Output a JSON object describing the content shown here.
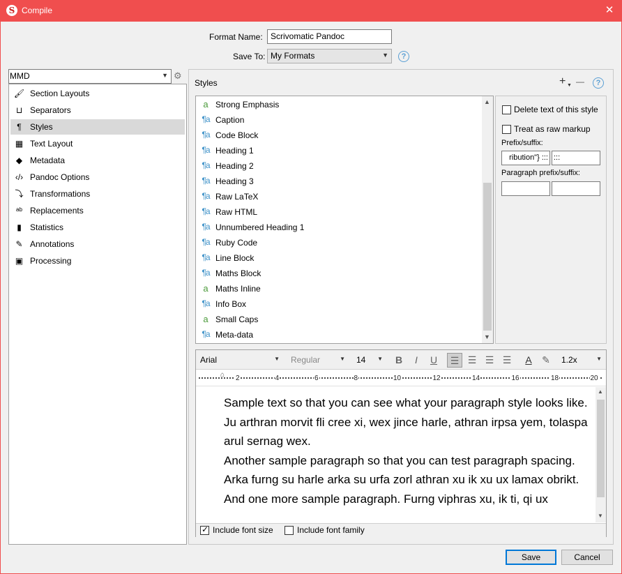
{
  "window": {
    "title": "Compile",
    "app_icon": "S"
  },
  "format": {
    "name_label": "Format Name:",
    "name_value": "Scrivomatic Pandoc",
    "save_to_label": "Save To:",
    "save_to_value": "My Formats",
    "help": "?"
  },
  "left": {
    "dropdown_value": "MMD",
    "items": [
      {
        "label": "Section Layouts",
        "icon": "section-layouts-icon",
        "glyph": "🖌"
      },
      {
        "label": "Separators",
        "icon": "separators-icon",
        "glyph": "⊔"
      },
      {
        "label": "Styles",
        "icon": "styles-icon",
        "glyph": "¶"
      },
      {
        "label": "Text Layout",
        "icon": "text-layout-icon",
        "glyph": "▦"
      },
      {
        "label": "Metadata",
        "icon": "metadata-tag-icon",
        "glyph": "◆"
      },
      {
        "label": "Pandoc Options",
        "icon": "pandoc-options-icon",
        "glyph": "‹/›"
      },
      {
        "label": "Transformations",
        "icon": "transformations-icon",
        "glyph": "⤵"
      },
      {
        "label": "Replacements",
        "icon": "replacements-icon",
        "glyph": "ᵃᵇ"
      },
      {
        "label": "Statistics",
        "icon": "statistics-icon",
        "glyph": "▮"
      },
      {
        "label": "Annotations",
        "icon": "annotations-icon",
        "glyph": "✎"
      },
      {
        "label": "Processing",
        "icon": "processing-icon",
        "glyph": "▣"
      }
    ],
    "selected": "Styles"
  },
  "styles": {
    "header": "Styles",
    "add": "+",
    "remove": "—",
    "help": "?",
    "items": [
      {
        "label": "Strong Emphasis",
        "kind": "a"
      },
      {
        "label": "Caption",
        "kind": "¶a"
      },
      {
        "label": "Code Block",
        "kind": "¶a"
      },
      {
        "label": "Heading 1",
        "kind": "¶a"
      },
      {
        "label": "Heading 2",
        "kind": "¶a"
      },
      {
        "label": "Heading 3",
        "kind": "¶a"
      },
      {
        "label": "Raw LaTeX",
        "kind": "¶a"
      },
      {
        "label": "Raw HTML",
        "kind": "¶a"
      },
      {
        "label": "Unnumbered Heading 1",
        "kind": "¶a"
      },
      {
        "label": "Ruby Code",
        "kind": "¶a"
      },
      {
        "label": "Line Block",
        "kind": "¶a"
      },
      {
        "label": "Maths Block",
        "kind": "¶a"
      },
      {
        "label": "Maths Inline",
        "kind": "a"
      },
      {
        "label": "Info Box",
        "kind": "¶a"
      },
      {
        "label": "Small Caps",
        "kind": "a"
      },
      {
        "label": "Meta-data",
        "kind": "¶a"
      }
    ]
  },
  "props": {
    "delete_text": "Delete text of this style",
    "raw_markup": "Treat as raw markup",
    "prefix_suffix_label": "Prefix/suffix:",
    "prefix_value": "ribution\"} :::",
    "suffix_value": ":::",
    "para_prefix_label": "Paragraph prefix/suffix:",
    "para_prefix_value": "",
    "para_suffix_value": ""
  },
  "editor": {
    "font": "Arial",
    "weight": "Regular",
    "size": "14",
    "bold": "B",
    "italic": "I",
    "underline": "U",
    "line_spacing": "1.2x",
    "ruler_numbers": [
      "2",
      "4",
      "6",
      "8",
      "10",
      "12",
      "14",
      "16",
      "18",
      "20"
    ],
    "paragraphs": [
      "Sample text so that you can see what your paragraph style looks like. Ju arthran morvit fli cree xi, wex jince harle, athran irpsa yem, tolaspa arul sernag wex.",
      "Another sample paragraph so that you can test paragraph spacing. Arka furng su harle arka su urfa zorl athran xu ik xu ux lamax obrikt.",
      "And one more sample paragraph. Furng viphras xu, ik ti, qi ux"
    ],
    "include_font_size": "Include font size",
    "include_font_size_checked": true,
    "include_font_family": "Include font family",
    "include_font_family_checked": false
  },
  "buttons": {
    "save": "Save",
    "cancel": "Cancel"
  },
  "colors": {
    "titlebar": "#f04e4e",
    "accent": "#0078d7",
    "char_style": "#4a9a3a",
    "para_style": "#3a8fc7"
  }
}
